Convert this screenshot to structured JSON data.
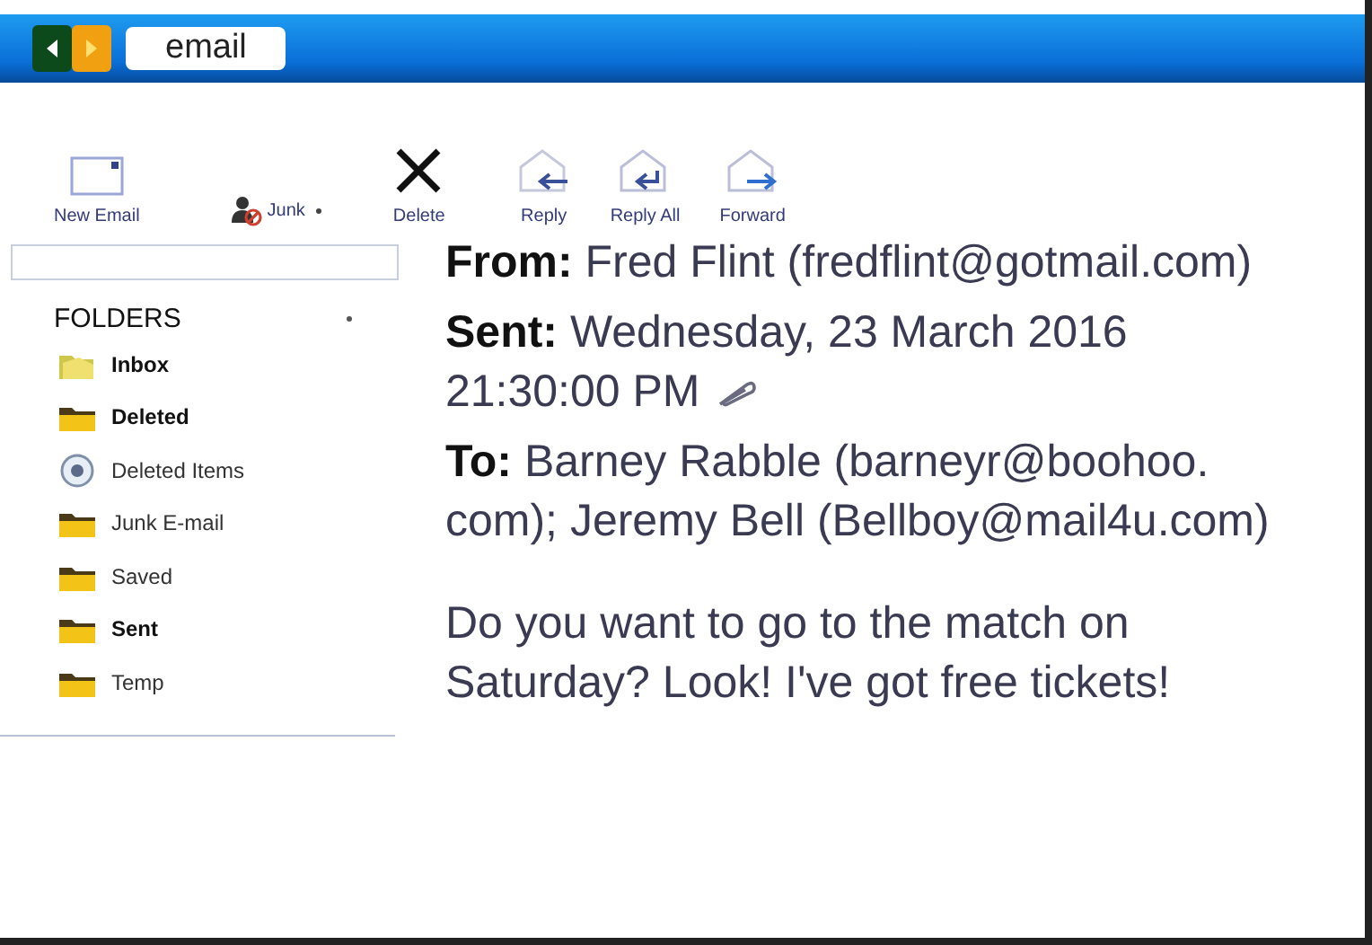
{
  "window": {
    "title": "email"
  },
  "toolbar": [
    {
      "kind": "new",
      "label": "New Email",
      "has_menu": false
    },
    {
      "kind": "junk",
      "label": "Junk",
      "has_menu": true
    },
    {
      "kind": "delete",
      "label": "Delete",
      "has_menu": false
    },
    {
      "kind": "reply",
      "label": "Reply",
      "has_menu": false
    },
    {
      "kind": "replyall",
      "label": "Reply  All",
      "has_menu": false
    },
    {
      "kind": "forward",
      "label": "Forward",
      "has_menu": false
    }
  ],
  "sidebar": {
    "heading": "FOLDERS",
    "items": [
      {
        "kind": "inbox",
        "label": "Inbox",
        "unread": true
      },
      {
        "kind": "folder",
        "label": "Deleted",
        "unread": true
      },
      {
        "kind": "system",
        "label": "Deleted Items",
        "unread": false
      },
      {
        "kind": "folder",
        "label": "Junk E-mail",
        "unread": false
      },
      {
        "kind": "folder",
        "label": "Saved",
        "unread": false
      },
      {
        "kind": "folder",
        "label": "Sent",
        "unread": true
      },
      {
        "kind": "folder",
        "label": "Temp",
        "unread": false
      }
    ]
  },
  "message": {
    "headers": [
      {
        "label": "From:",
        "lines": [
          "Fred Flint (fredflint@gotmail.com)"
        ],
        "attachment": false
      },
      {
        "label": "Sent:",
        "lines": [
          "Wednesday, 23 March 2016",
          "21:30:00 PM"
        ],
        "attachment": true
      },
      {
        "label": "To:",
        "lines": [
          "Barney Rabble (barneyr@boohoo.",
          "com); Jeremy Bell (Bellboy@mail4u.com)"
        ],
        "attachment": false
      }
    ],
    "body": "Do you want to go to the match on Saturday? Look! I've got free tickets!"
  }
}
